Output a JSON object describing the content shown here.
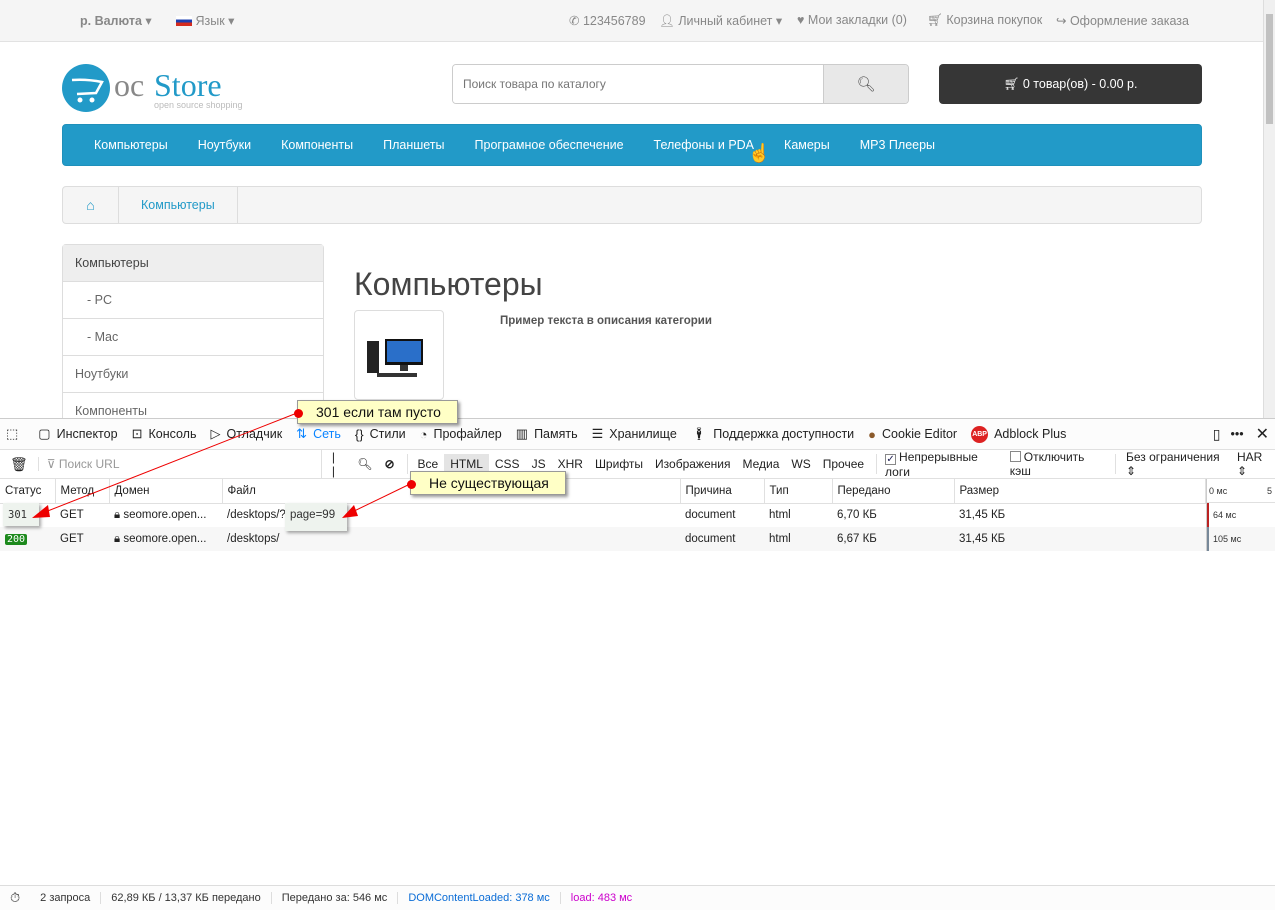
{
  "topbar": {
    "currency": "р. Валюта",
    "language": "Язык",
    "phone": "123456789",
    "account": "Личный кабинет",
    "wishlist": "Мои закладки (0)",
    "cart": "Корзина покупок",
    "checkout": "Оформление заказа"
  },
  "logo": {
    "text_oc": "oc",
    "text_store": "Store",
    "tagline": "open source shopping"
  },
  "search": {
    "placeholder": "Поиск товара по каталогу"
  },
  "cart_button": "0 товар(ов) - 0.00 р.",
  "menu": [
    "Компьютеры",
    "Ноутбуки",
    "Компоненты",
    "Планшеты",
    "Програмное обеспечение",
    "Телефоны и PDA",
    "Камеры",
    "MP3 Плееры"
  ],
  "breadcrumb": {
    "item": "Компьютеры"
  },
  "sidebar": [
    "Компьютеры",
    "- PC",
    "- Mac",
    "Ноутбуки",
    "Компоненты"
  ],
  "category": {
    "title": "Компьютеры",
    "description": "Пример текста в описания категории"
  },
  "devtools": {
    "tools": [
      "Инспектор",
      "Консоль",
      "Отладчик",
      "Сеть",
      "Стили",
      "Профайлер",
      "Память",
      "Хранилище",
      "Поддержка доступности",
      "Cookie Editor",
      "Adblock Plus"
    ],
    "filter_placeholder": "Поиск URL",
    "filters": [
      "Все",
      "HTML",
      "CSS",
      "JS",
      "XHR",
      "Шрифты",
      "Изображения",
      "Медиа",
      "WS",
      "Прочее"
    ],
    "persist_logs": "Непрерывные логи",
    "disable_cache": "Отключить кэш",
    "throttle": "Без ограничения ⇕",
    "har": "HAR ⇕",
    "columns": [
      "Статус",
      "Метод",
      "Домен",
      "Файл",
      "Причина",
      "Тип",
      "Передано",
      "Размер"
    ],
    "timeline_labels": [
      "0 мс",
      "5"
    ],
    "rows": [
      {
        "status": "301",
        "method": "GET",
        "domain": "seomore.open...",
        "file": "/desktops/?page=99",
        "cause": "document",
        "type": "html",
        "transferred": "6,70 КБ",
        "size": "31,45 КБ",
        "time": "64 мс"
      },
      {
        "status": "200",
        "method": "GET",
        "domain": "seomore.open...",
        "file": "/desktops/",
        "cause": "document",
        "type": "html",
        "transferred": "6,67 КБ",
        "size": "31,45 КБ",
        "time": "105 мс"
      }
    ],
    "statusbar": {
      "requests": "2 запроса",
      "size": "62,89 КБ / 13,37 КБ передано",
      "finish": "Передано за: 546 мс",
      "dcl": "DOMContentLoaded: 378 мс",
      "load": "load: 483 мс"
    }
  },
  "annotations": {
    "note1": "301 если там пусто",
    "note2": "Не существующая"
  }
}
